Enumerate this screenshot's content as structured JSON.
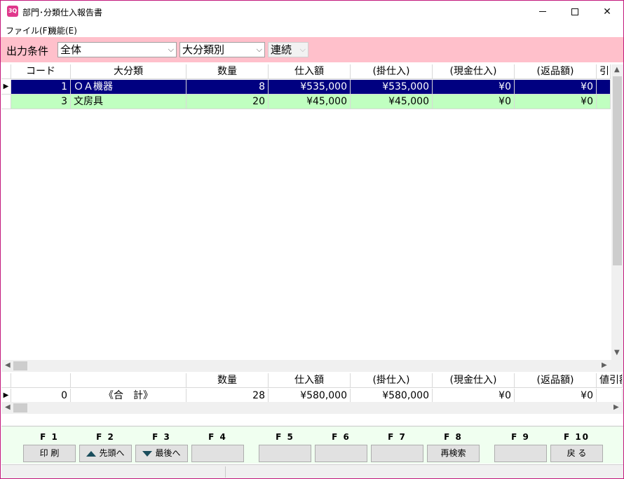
{
  "window": {
    "title": "部門･分類仕入報告書",
    "app_icon": "3Q"
  },
  "menu": [
    {
      "label": "ファイル(F)"
    },
    {
      "label": "機能(E)"
    }
  ],
  "filter": {
    "label": "出力条件",
    "scope": "全体",
    "grouping": "大分類別",
    "mode": "連続"
  },
  "main_grid": {
    "columns": [
      "コード",
      "大分類",
      "数量",
      "仕入額",
      "(掛仕入)",
      "(現金仕入)",
      "(返品額)",
      "引"
    ],
    "rows": [
      {
        "code": "1",
        "category": "ＯＡ機器",
        "qty": "8",
        "purchase": "¥535,000",
        "credit": "¥535,000",
        "cash": "¥0",
        "returns": "¥0",
        "selected": true
      },
      {
        "code": "3",
        "category": "文房具",
        "qty": "20",
        "purchase": "¥45,000",
        "credit": "¥45,000",
        "cash": "¥0",
        "returns": "¥0",
        "selected": false
      }
    ]
  },
  "total_grid": {
    "columns": [
      "数量",
      "仕入額",
      "(掛仕入)",
      "(現金仕入)",
      "(返品額)",
      "値引額"
    ],
    "row": {
      "code": "0",
      "label": "《合　計》",
      "qty": "28",
      "purchase": "¥580,000",
      "credit": "¥580,000",
      "cash": "¥0",
      "returns": "¥0"
    }
  },
  "fkeys": [
    {
      "key": "F 1",
      "label": "印 刷",
      "icon": ""
    },
    {
      "key": "F 2",
      "label": "先頭へ",
      "icon": "up-arrow-icon"
    },
    {
      "key": "F 3",
      "label": "最後へ",
      "icon": "down-arrow-icon"
    },
    {
      "key": "F 4",
      "label": ""
    },
    {
      "key": "F 5",
      "label": ""
    },
    {
      "key": "F 6",
      "label": ""
    },
    {
      "key": "F 7",
      "label": ""
    },
    {
      "key": "F 8",
      "label": "再検索"
    },
    {
      "key": "F 9",
      "label": ""
    },
    {
      "key": "F 10",
      "label": "戻 る"
    }
  ],
  "colors": {
    "border": "#c2187c",
    "filter_bg": "#ffc0cb",
    "selected_row": "#000080",
    "green_row": "#c0ffc0",
    "fkey_bg": "#f0fff0"
  }
}
